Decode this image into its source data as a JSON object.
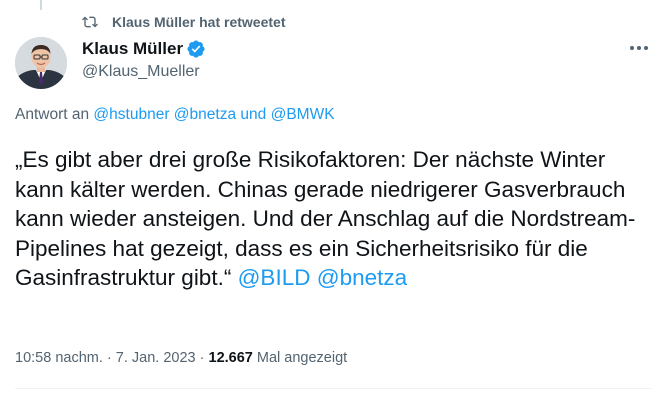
{
  "retweet": {
    "icon": "retweet-icon",
    "text": "Klaus Müller hat retweetet"
  },
  "author": {
    "name": "Klaus Müller",
    "handle": "@Klaus_Mueller",
    "verified": true,
    "avatar_icon": "profile-photo"
  },
  "reply": {
    "prefix": "Antwort an",
    "mention1": "@hstubner",
    "mention2": "@bnetza",
    "connector": "und",
    "mention3": "@BMWK"
  },
  "tweet": {
    "text": "„Es gibt aber drei große Risikofaktoren: Der nächste Winter kann kälter werden. Chinas gerade niedrigerer Gasverbrauch kann wieder ansteigen. Und der Anschlag auf die Nordstream-Pipelines hat gezeigt, dass es ein Sicherheitsrisiko für die Gasinfrastruktur gibt.“",
    "mention1": "@BILD",
    "mention2": "@bnetza"
  },
  "meta": {
    "time": "10:58 nachm.",
    "sep1": "·",
    "date": "7. Jan. 2023",
    "sep2": "·",
    "views": "12.667",
    "views_label": "Mal angezeigt"
  },
  "colors": {
    "accent": "#1d9bf0",
    "secondary_text": "#536471",
    "primary_text": "#0f1419"
  }
}
